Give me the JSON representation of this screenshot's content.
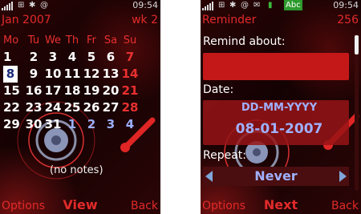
{
  "left": {
    "time": "09:54",
    "title": "Jan 2007",
    "week": "wk 2",
    "days": [
      "Mo",
      "Tu",
      "We",
      "Th",
      "Fr",
      "Sa",
      "Su"
    ],
    "weeks": [
      [
        "1",
        "2",
        "3",
        "4",
        "5",
        "6",
        "7"
      ],
      [
        "8",
        "9",
        "10",
        "11",
        "12",
        "13",
        "14"
      ],
      [
        "15",
        "16",
        "17",
        "18",
        "19",
        "20",
        "21"
      ],
      [
        "22",
        "23",
        "24",
        "25",
        "26",
        "27",
        "28"
      ],
      [
        "29",
        "30",
        "31",
        "1",
        "2",
        "3",
        "4"
      ]
    ],
    "selected_day": "8",
    "notes": "(no notes)",
    "softkeys": {
      "left": "Options",
      "center": "View",
      "right": "Back"
    }
  },
  "right": {
    "time": "09:54",
    "title": "Reminder",
    "chars_left": "256",
    "input_mode": "Abc",
    "remind_label": "Remind about:",
    "remind_value": "",
    "date_label": "Date:",
    "date_format": "DD-MM-YYYY",
    "date_value": "08-01-2007",
    "repeat_label": "Repeat:",
    "repeat_value": "Never",
    "softkeys": {
      "left": "Options",
      "center": "Next",
      "right": "Back"
    }
  },
  "colors": {
    "accent_red": "#e22a2a",
    "field_red": "#c41818",
    "link_blue": "#9fb0ff",
    "background": "#1a0304"
  }
}
